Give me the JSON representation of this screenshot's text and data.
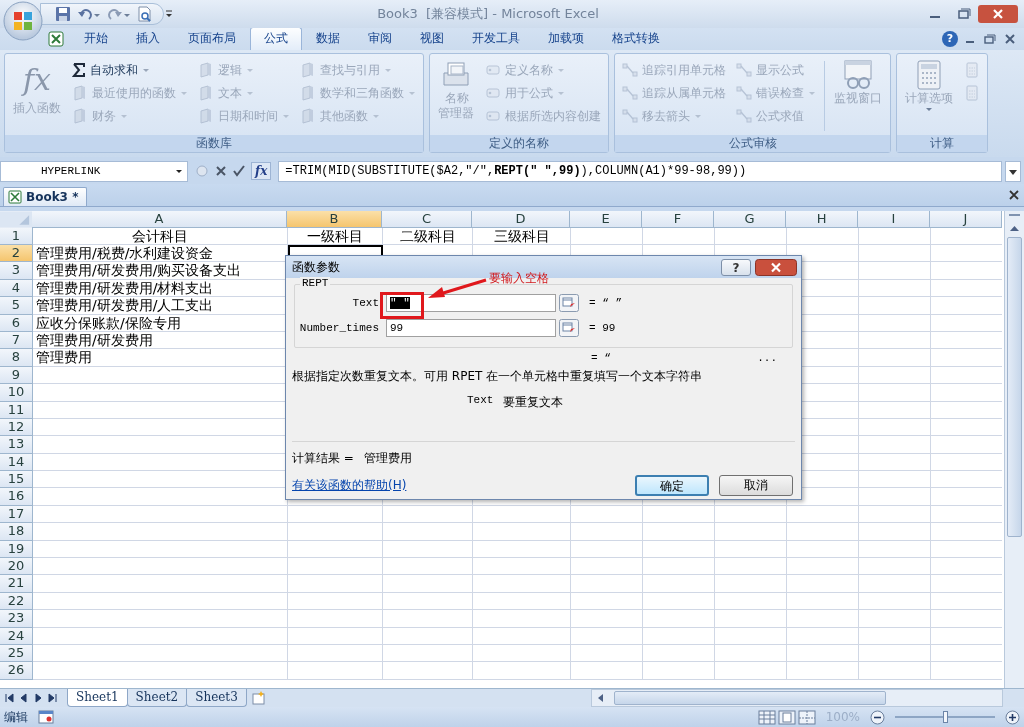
{
  "window": {
    "title": "Book3  [兼容模式] - Microsoft Excel"
  },
  "ribbon_tabs": [
    {
      "label": "开始",
      "selected": false
    },
    {
      "label": "插入",
      "selected": false
    },
    {
      "label": "页面布局",
      "selected": false
    },
    {
      "label": "公式",
      "selected": true
    },
    {
      "label": "数据",
      "selected": false
    },
    {
      "label": "审阅",
      "selected": false
    },
    {
      "label": "视图",
      "selected": false
    },
    {
      "label": "开发工具",
      "selected": false
    },
    {
      "label": "加载项",
      "selected": false
    },
    {
      "label": "格式转换",
      "selected": false
    }
  ],
  "help": "?",
  "ribbon_groups": [
    {
      "title": "函数库",
      "sections": [
        {
          "kind": "large",
          "glyph": "fx",
          "label": "插入函数",
          "disabled": true,
          "dropdown": false
        },
        {
          "kind": "column",
          "items": [
            {
              "label": "自动求和",
              "disabled": false,
              "dropdown": true
            },
            {
              "label": "最近使用的函数",
              "disabled": true,
              "dropdown": true
            },
            {
              "label": "财务",
              "disabled": true,
              "dropdown": true
            }
          ]
        },
        {
          "kind": "column",
          "items": [
            {
              "label": "逻辑",
              "disabled": true,
              "dropdown": true
            },
            {
              "label": "文本",
              "disabled": true,
              "dropdown": true
            },
            {
              "label": "日期和时间",
              "disabled": true,
              "dropdown": true
            }
          ]
        },
        {
          "kind": "column",
          "items": [
            {
              "label": "查找与引用",
              "disabled": true,
              "dropdown": true
            },
            {
              "label": "数学和三角函数",
              "disabled": true,
              "dropdown": true
            },
            {
              "label": "其他函数",
              "disabled": true,
              "dropdown": true
            }
          ]
        }
      ]
    },
    {
      "title": "定义的名称",
      "sections": [
        {
          "kind": "large",
          "label": "名称管理器",
          "disabled": true,
          "dropdown": false
        },
        {
          "kind": "column",
          "items": [
            {
              "label": "定义名称",
              "disabled": true,
              "dropdown": true
            },
            {
              "label": "用于公式",
              "disabled": true,
              "dropdown": true
            },
            {
              "label": "根据所选内容创建",
              "disabled": true,
              "dropdown": false
            }
          ]
        }
      ]
    },
    {
      "title": "公式审核",
      "sections": [
        {
          "kind": "column",
          "items": [
            {
              "label": "追踪引用单元格",
              "disabled": true,
              "dropdown": false
            },
            {
              "label": "追踪从属单元格",
              "disabled": true,
              "dropdown": false
            },
            {
              "label": "移去箭头",
              "disabled": true,
              "dropdown": true
            }
          ]
        },
        {
          "kind": "column",
          "items": [
            {
              "label": "显示公式",
              "disabled": true,
              "dropdown": false
            },
            {
              "label": "错误检查",
              "disabled": true,
              "dropdown": true
            },
            {
              "label": "公式求值",
              "disabled": true,
              "dropdown": false
            }
          ]
        },
        {
          "kind": "large",
          "label": "监视窗口",
          "disabled": true,
          "dropdown": false
        }
      ]
    },
    {
      "title": "计算",
      "sections": [
        {
          "kind": "large",
          "label": "计算选项",
          "disabled": true,
          "dropdown": true
        },
        {
          "kind": "column",
          "items": [
            {
              "disabled": true,
              "dropdown": false
            },
            {
              "disabled": true,
              "dropdown": false
            }
          ]
        }
      ]
    }
  ],
  "formula_bar": {
    "name_box": "HYPERLINK",
    "insert_function": "fx",
    "formula": "=TRIM(MID(SUBSTITUTE($A2,\"/\",**REPT(\" \",99)**),COLUMN(A1)*99-98,99))"
  },
  "workbook_tab": {
    "label": "Book3 *"
  },
  "sheet": {
    "columns": [
      {
        "label": "A",
        "selected": false
      },
      {
        "label": "B",
        "selected": true
      },
      {
        "label": "C",
        "selected": false
      },
      {
        "label": "D",
        "selected": false
      },
      {
        "label": "E",
        "selected": false
      },
      {
        "label": "F",
        "selected": false
      },
      {
        "label": "G",
        "selected": false
      },
      {
        "label": "H",
        "selected": false
      },
      {
        "label": "I",
        "selected": false
      },
      {
        "label": "J",
        "selected": false
      }
    ],
    "rows": [
      {
        "number": "1",
        "selected": false,
        "cells": [
          {
            "text": "会计科目",
            "active": false
          },
          {
            "text": "一级科目",
            "active": false
          },
          {
            "text": "二级科目",
            "active": false
          },
          {
            "text": "三级科目",
            "active": false
          }
        ]
      },
      {
        "number": "2",
        "selected": true,
        "cells": [
          {
            "text": "管理费用/税费/水利建设资金",
            "active": false
          },
          {
            "active": true
          }
        ]
      },
      {
        "number": "3",
        "selected": false,
        "cells": [
          {
            "text": "管理费用/研发费用/购买设备支出",
            "active": false
          }
        ]
      },
      {
        "number": "4",
        "selected": false,
        "cells": [
          {
            "text": "管理费用/研发费用/材料支出",
            "active": false
          }
        ]
      },
      {
        "number": "5",
        "selected": false,
        "cells": [
          {
            "text": "管理费用/研发费用/人工支出",
            "active": false
          }
        ]
      },
      {
        "number": "6",
        "selected": false,
        "cells": [
          {
            "text": "应收分保账款/保险专用",
            "active": false
          }
        ]
      },
      {
        "number": "7",
        "selected": false,
        "cells": [
          {
            "text": "管理费用/研发费用",
            "active": false
          }
        ]
      },
      {
        "number": "8",
        "selected": false,
        "cells": [
          {
            "text": "管理费用",
            "active": false
          }
        ]
      },
      {
        "number": "9",
        "selected": false
      },
      {
        "number": "10",
        "selected": false
      },
      {
        "number": "11",
        "selected": false
      },
      {
        "number": "12",
        "selected": false
      },
      {
        "number": "13",
        "selected": false
      },
      {
        "number": "14",
        "selected": false
      },
      {
        "number": "15",
        "selected": false
      },
      {
        "number": "16",
        "selected": false
      },
      {
        "number": "17",
        "selected": false
      },
      {
        "number": "18",
        "selected": false
      },
      {
        "number": "19",
        "selected": false
      },
      {
        "number": "20",
        "selected": false
      },
      {
        "number": "21",
        "selected": false
      },
      {
        "number": "22",
        "selected": false
      },
      {
        "number": "23",
        "selected": false
      },
      {
        "number": "24",
        "selected": false
      },
      {
        "number": "25",
        "selected": false
      },
      {
        "number": "26",
        "selected": false
      }
    ]
  },
  "dialog": {
    "title": "函数参数",
    "help": "?",
    "function_name": "REPT",
    "args": [
      {
        "label": "Text",
        "value": "\" \"",
        "text_selected": true,
        "result": "= “ ”"
      },
      {
        "label": "Number_times",
        "value": "99",
        "text_selected": false,
        "result": "= 99"
      }
    ],
    "overall_result": "= “",
    "ellipsis": "...",
    "description": "根据指定次数重复文本。可用 RPET 在一个单元格中重复填写一个文本字符串",
    "arg_help_label": "Text",
    "arg_help": "要重复文本",
    "calc_label": "计算结果 =",
    "calc_value": "管理费用",
    "help_link": "有关该函数的帮助(H)",
    "buttons": [
      {
        "label": "确定",
        "default": true
      },
      {
        "label": "取消",
        "default": false
      }
    ]
  },
  "annotation": {
    "text": "要输入空格"
  },
  "sheet_tabs": [
    {
      "label": "Sheet1",
      "selected": true
    },
    {
      "label": "Sheet2",
      "selected": false
    },
    {
      "label": "Sheet3",
      "selected": false
    }
  ],
  "status_bar": {
    "mode": "编辑",
    "zoom": "100%",
    "zoom_slider": {
      "level": 0.5
    }
  }
}
